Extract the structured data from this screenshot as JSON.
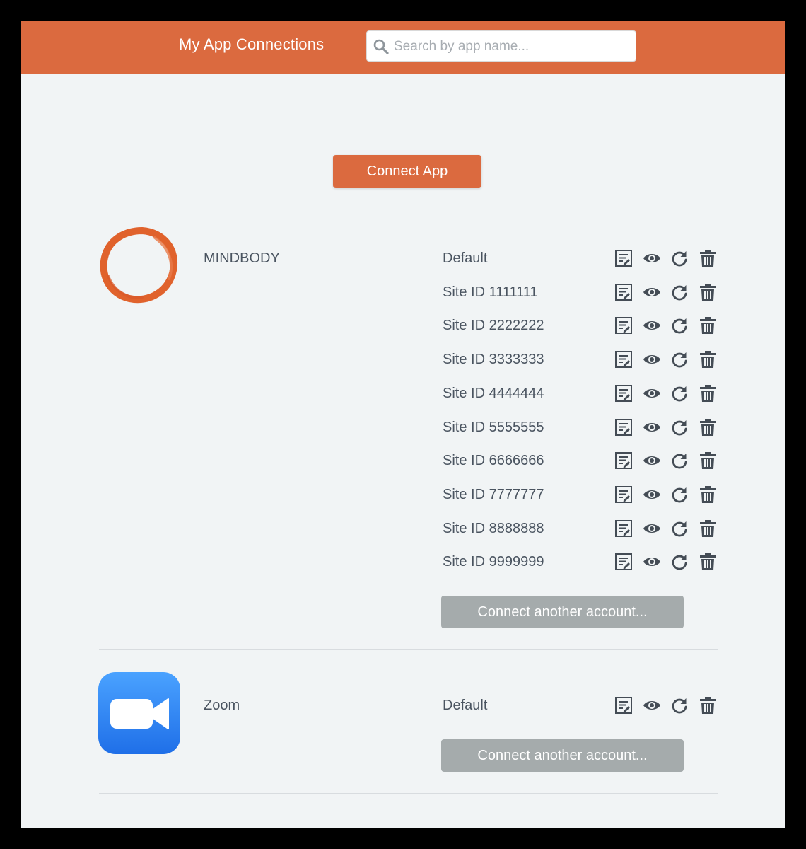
{
  "header": {
    "title": "My App Connections",
    "search_placeholder": "Search by app name..."
  },
  "connect_app_label": "Connect App",
  "connect_another_label": "Connect another account...",
  "icons": {
    "edit": "edit-note-icon",
    "view": "eye-icon",
    "refresh": "refresh-icon",
    "delete": "trash-icon"
  },
  "colors": {
    "accent": "#db6a3f",
    "secondary_button": "#a5abac",
    "icon": "#444c55",
    "zoom_blue": "#2d8cff"
  },
  "apps": [
    {
      "name": "MINDBODY",
      "accounts": [
        "Default",
        "Site ID 1111111",
        "Site ID 2222222",
        "Site ID 3333333",
        "Site ID 4444444",
        "Site ID 5555555",
        "Site ID 6666666",
        "Site ID 7777777",
        "Site ID 8888888",
        "Site ID 9999999"
      ]
    },
    {
      "name": "Zoom",
      "accounts": [
        "Default"
      ]
    }
  ]
}
